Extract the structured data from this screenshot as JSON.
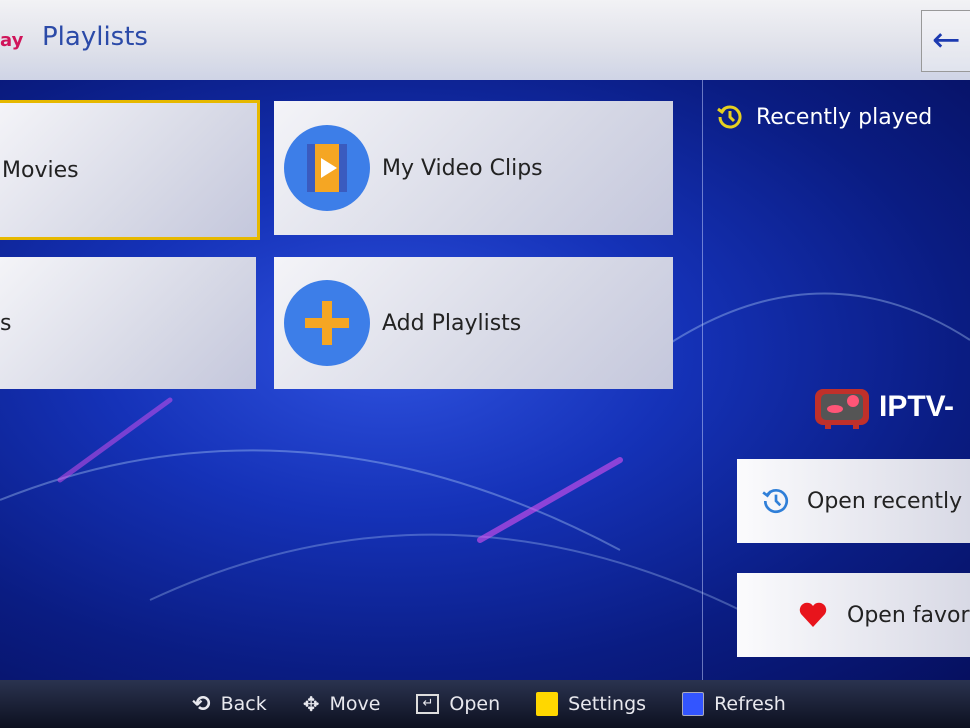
{
  "header": {
    "brand_fragment": "ay",
    "title": "Playlists",
    "back_icon": "arrow-left-icon"
  },
  "tiles": [
    {
      "label": "Movies",
      "focused": true
    },
    {
      "label": "My Video Clips",
      "icon": "video-clip-icon"
    },
    {
      "label": "s"
    },
    {
      "label": "Add Playlists",
      "icon": "plus-icon"
    }
  ],
  "sidebar": {
    "recently_played": "Recently played",
    "logo_text": "IPTV-",
    "open_recent": "Open recently",
    "open_favorites": "Open favor"
  },
  "footer": {
    "back": "Back",
    "move": "Move",
    "open": "Open",
    "settings": "Settings",
    "refresh": "Refresh"
  },
  "colors": {
    "accent": "#e6b800",
    "settings_key": "#ffd700",
    "refresh_key": "#3355ff",
    "title": "#2b4aa8"
  }
}
